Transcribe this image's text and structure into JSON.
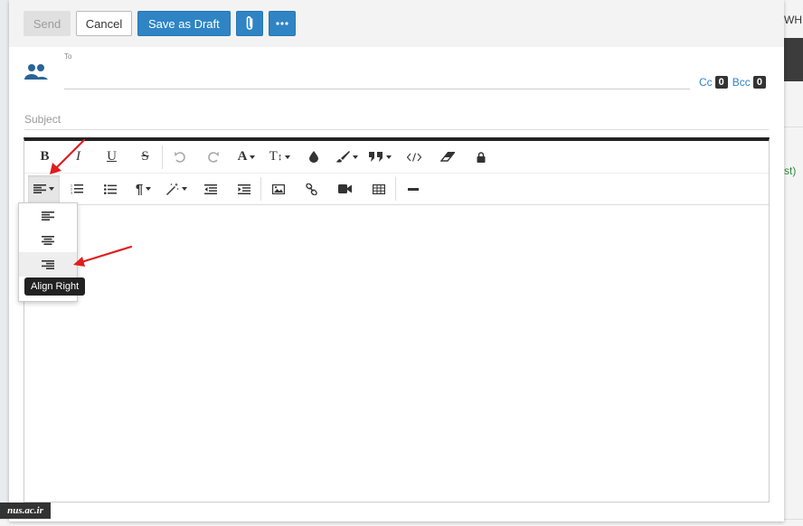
{
  "background": {
    "corner_text": "WHM",
    "side_text": "st)"
  },
  "toolbar": {
    "send_label": "Send",
    "cancel_label": "Cancel",
    "save_draft_label": "Save as Draft",
    "attach_icon": "paperclip-icon",
    "more_icon": "ellipsis-icon"
  },
  "compose": {
    "to_label": "To",
    "cc_label": "Cc",
    "cc_count": "0",
    "bcc_label": "Bcc",
    "bcc_count": "0",
    "subject_placeholder": "Subject"
  },
  "editor_toolbar": {
    "row1": [
      "bold",
      "italic",
      "underline",
      "strikethrough",
      "undo",
      "redo",
      "font-size",
      "text-height",
      "color",
      "highlight",
      "blockquote",
      "code-view",
      "eraser",
      "lock"
    ],
    "row2": [
      "align",
      "ordered-list",
      "unordered-list",
      "paragraph",
      "magic",
      "outdent",
      "indent",
      "image",
      "link",
      "video",
      "table",
      "horizontal-rule"
    ],
    "bold_label": "B",
    "italic_label": "I",
    "underline_label": "U",
    "strike_label": "S",
    "font_label": "A",
    "height_label": "T",
    "para_label": "¶"
  },
  "align_dropdown": {
    "items": [
      "align-left",
      "align-center",
      "align-right"
    ],
    "tooltip": "Align Right"
  },
  "watermark": {
    "text": "nus.ac.ir"
  },
  "colors": {
    "primary": "#2f84c4",
    "annotation_arrow": "#e11d1d",
    "editor_border_top": "#222222"
  }
}
